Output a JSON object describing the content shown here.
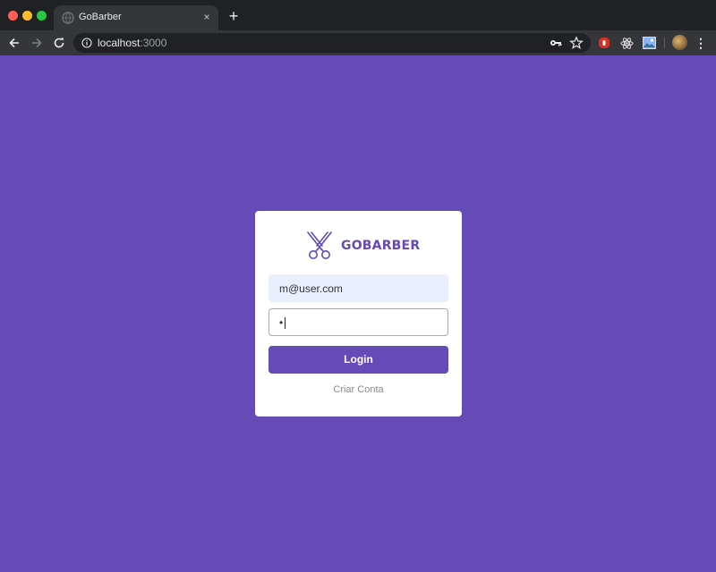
{
  "browser": {
    "tab_title": "GoBarber",
    "tab_close": "×",
    "new_tab": "+",
    "url_host": "localhost",
    "url_port": ":3000",
    "menu_glyph": "⋮"
  },
  "login": {
    "brand": "GOBARBER",
    "email_value": "m@user.com",
    "password_value": "•",
    "submit_label": "Login",
    "create_account_label": "Criar Conta"
  },
  "colors": {
    "brand": "#644bb6",
    "email_autofill": "#e8f0fe",
    "browser_dark": "#202124",
    "toolbar": "#35363a"
  },
  "icons": [
    "back-arrow-icon",
    "forward-arrow-icon",
    "reload-icon",
    "info-icon",
    "key-icon",
    "star-icon",
    "scissors-icon"
  ]
}
